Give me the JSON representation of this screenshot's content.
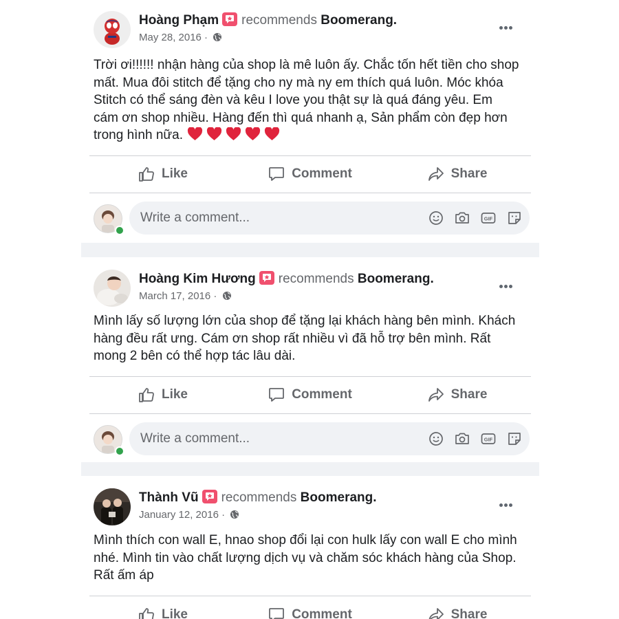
{
  "posts": [
    {
      "author": "Hoàng Phạm",
      "recommends": "recommends",
      "page": "Boomerang.",
      "date": "May 28, 2016 ·",
      "text": "Trời ơi!!!!!! nhận hàng của shop là mê luôn ấy. Chắc tốn hết tiền cho shop mất. Mua đôi stitch để tặng cho ny mà ny em thích quá luôn. Móc khóa Stitch có thể sáng đèn và kêu I love you thật sự là quá đáng yêu. Em cám ơn shop nhiều. Hàng đến thì quá nhanh ạ, Sản phẩm còn đẹp hơn trong hình nữa."
    },
    {
      "author": "Hoàng Kim Hương",
      "recommends": "recommends",
      "page": "Boomerang.",
      "date": "March 17, 2016 ·",
      "text": "Mình lấy số lượng lớn của shop để tặng lại khách hàng bên mình. Khách hàng đều rất ưng. Cám ơn shop rất nhiều vì đã hỗ trợ bên mình. Rất mong 2 bên có thể hợp tác lâu dài."
    },
    {
      "author": "Thành Vũ",
      "recommends": "recommends",
      "page": "Boomerang.",
      "date": "January 12, 2016 ·",
      "text": "Mình thích con wall E, hnao shop đổi lại con hulk lấy con wall E cho mình nhé. Mình tin vào chất lượng dịch vụ và chăm sóc khách hàng của Shop. Rất ấm áp"
    }
  ],
  "actions": {
    "like": "Like",
    "comment": "Comment",
    "share": "Share"
  },
  "comment_placeholder": "Write a comment...",
  "icons": {
    "recommend": "recommend-badge-icon",
    "privacy": "globe-icon",
    "more": "more-options-icon",
    "like": "thumbs-up-icon",
    "comment": "speech-bubble-icon",
    "share": "share-arrow-icon",
    "emoji": "smiley-icon",
    "camera": "camera-icon",
    "gif": "gif-icon",
    "sticker": "sticker-icon",
    "heart": "red-heart-icon"
  },
  "colors": {
    "badge": "#f0506e",
    "heart": "#e0243c",
    "muted": "#65676b",
    "online": "#31a24c"
  }
}
